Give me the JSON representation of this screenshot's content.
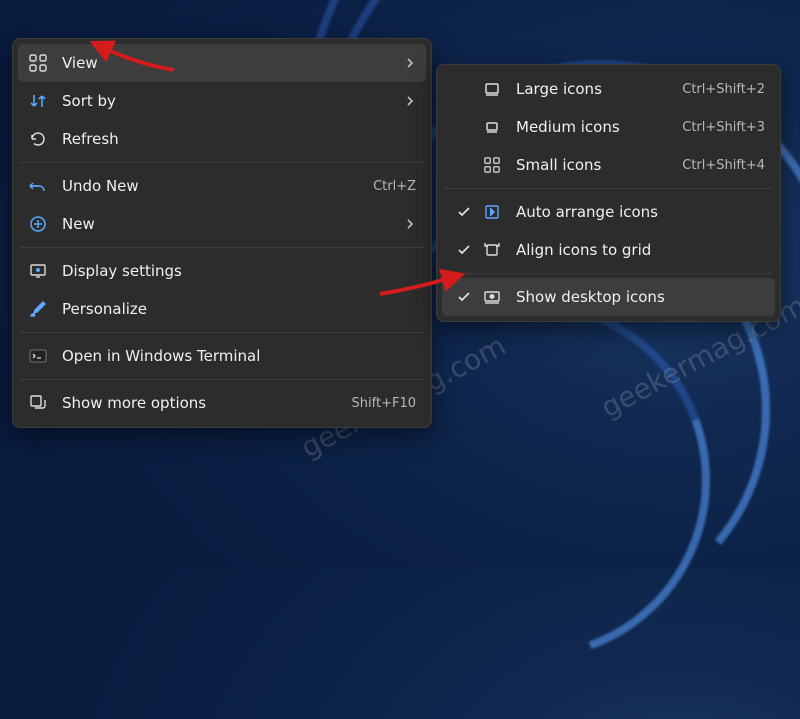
{
  "watermark": "geekermag.com",
  "main_menu": {
    "items": [
      {
        "label": "View",
        "has_submenu": true,
        "highlighted": true
      },
      {
        "label": "Sort by",
        "has_submenu": true
      },
      {
        "label": "Refresh"
      },
      {
        "label": "Undo New",
        "shortcut": "Ctrl+Z"
      },
      {
        "label": "New",
        "has_submenu": true
      },
      {
        "label": "Display settings"
      },
      {
        "label": "Personalize"
      },
      {
        "label": "Open in Windows Terminal"
      },
      {
        "label": "Show more options",
        "shortcut": "Shift+F10"
      }
    ]
  },
  "submenu": {
    "items": [
      {
        "label": "Large icons",
        "shortcut": "Ctrl+Shift+2"
      },
      {
        "label": "Medium icons",
        "shortcut": "Ctrl+Shift+3"
      },
      {
        "label": "Small icons",
        "shortcut": "Ctrl+Shift+4"
      },
      {
        "label": "Auto arrange icons",
        "checked": true
      },
      {
        "label": "Align icons to grid",
        "checked": true
      },
      {
        "label": "Show desktop icons",
        "checked": true,
        "highlighted": true
      }
    ]
  },
  "colors": {
    "menu_bg": "#2c2c2c",
    "menu_hl": "#3d3d3d",
    "text": "#f0f0f0",
    "arrow": "#d41c1c"
  }
}
